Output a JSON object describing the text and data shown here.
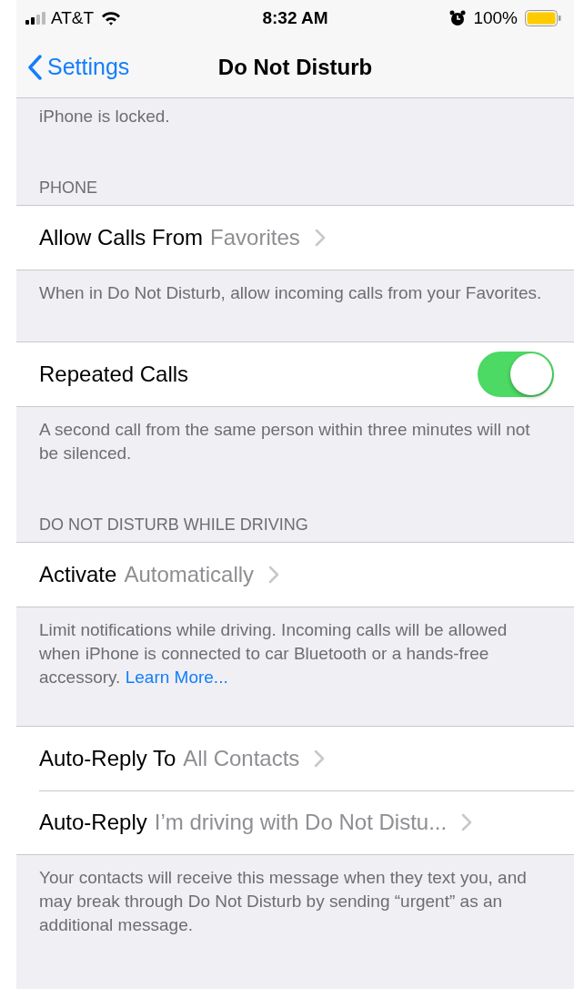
{
  "status_bar": {
    "carrier": "AT&T",
    "time": "8:32 AM",
    "battery": "100%"
  },
  "nav": {
    "back": "Settings",
    "title": "Do Not Disturb"
  },
  "top_note": "iPhone is locked.",
  "sections": [
    {
      "header": "PHONE",
      "cells": [
        {
          "kind": "disclosure",
          "label": "Allow Calls From",
          "value": "Favorites"
        }
      ],
      "footer": "When in Do Not Disturb, allow incoming calls from your Favorites."
    },
    {
      "cells": [
        {
          "kind": "toggle",
          "label": "Repeated Calls",
          "on": true
        }
      ],
      "footer": "A second call from the same person within three minutes will not be silenced."
    },
    {
      "header": "DO NOT DISTURB WHILE DRIVING",
      "cells": [
        {
          "kind": "disclosure",
          "label": "Activate",
          "value": "Automatically"
        }
      ],
      "footer": "Limit notifications while driving. Incoming calls will be allowed when iPhone is connected to car Bluetooth or a hands-free accessory.",
      "footer_link": "Learn More..."
    },
    {
      "cells": [
        {
          "kind": "disclosure",
          "label": "Auto-Reply To",
          "value": "All Contacts"
        },
        {
          "kind": "disclosure",
          "label": "Auto-Reply",
          "value": "I’m driving with Do Not Distu..."
        }
      ],
      "footer": "Your contacts will receive this message when they text you, and may break through Do Not Disturb by sending “urgent” as an additional message."
    }
  ]
}
